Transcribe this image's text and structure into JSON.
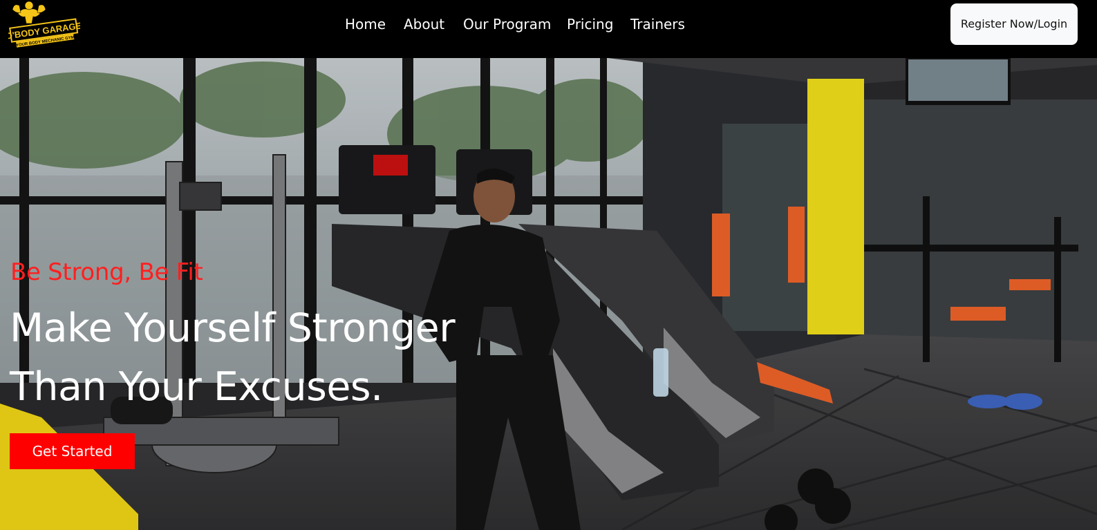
{
  "brand": {
    "logo_text": "D'BODY GARAGE",
    "logo_subtext": "YOUR BODY MECHANIC GYM"
  },
  "nav": {
    "items": [
      {
        "label": "Home"
      },
      {
        "label": "About"
      },
      {
        "label": "Our Program"
      },
      {
        "label": "Pricing"
      },
      {
        "label": "Trainers"
      }
    ],
    "register_label": "Register Now/Login"
  },
  "hero": {
    "tagline": "Be Strong, Be Fit",
    "headline_line1": "Make Yourself Stronger",
    "headline_line2": "Than Your Excuses.",
    "cta_label": "Get Started"
  },
  "colors": {
    "navbar_bg": "#000000",
    "accent_red": "#ff0000",
    "logo_yellow": "#f5c518",
    "pillar_yellow": "#f2e11b"
  }
}
